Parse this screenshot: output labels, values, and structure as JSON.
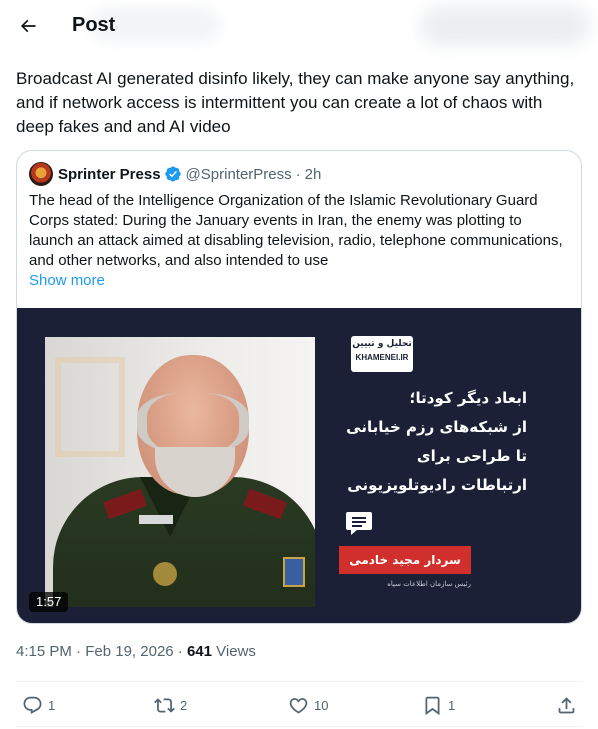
{
  "header": {
    "title": "Post",
    "back_icon": "arrow-left-icon"
  },
  "tweet": {
    "text": "Broadcast AI generated disinfo likely, they can make anyone say anything, and if network access is intermittent you can create a lot of chaos with deep fakes and and AI video"
  },
  "quote": {
    "name": "Sprinter Press",
    "verified_icon": "verified-badge-icon",
    "handle": "@SprinterPress",
    "separator": "·",
    "time": "2h",
    "text": "The head of the Intelligence Organization of the Islamic Revolutionary Guard Corps stated: During the January events in Iran, the enemy was plotting to launch an attack aimed at disabling television, radio, telephone communications, and other networks, and also intended to use",
    "show_more": "Show more",
    "media": {
      "logo_fa": "تحلیل و تبیین",
      "logo_en": "KHAMENEI.IR",
      "headline_lines": [
        "ابعاد دیگر کودتا؛",
        "از شبکه‌های رزم خیابانی",
        "تا طراحی برای",
        "ارتباطات رادیوتلویزیونی"
      ],
      "red_label": "سردار مجید خادمی",
      "sub_label": "رئیس سازمان اطلاعات سپاه",
      "duration": "1:57",
      "chat_icon": "chat-bubble-icon"
    }
  },
  "meta": {
    "time": "4:15 PM",
    "sep1": "·",
    "date": "Feb 19, 2026",
    "sep2": "·",
    "views_count": "641",
    "views_label": "Views"
  },
  "actions": {
    "reply": {
      "icon": "reply-icon",
      "count": "1"
    },
    "retweet": {
      "icon": "retweet-icon",
      "count": "2"
    },
    "like": {
      "icon": "heart-icon",
      "count": "10"
    },
    "bookmark": {
      "icon": "bookmark-icon",
      "count": "1"
    },
    "share": {
      "icon": "share-icon"
    }
  },
  "colors": {
    "accent": "#1d9bf0",
    "text": "#0f1419",
    "muted": "#536471",
    "border": "#cfd9de",
    "media_bg": "#1b2036",
    "red_label": "#d12f2b"
  }
}
